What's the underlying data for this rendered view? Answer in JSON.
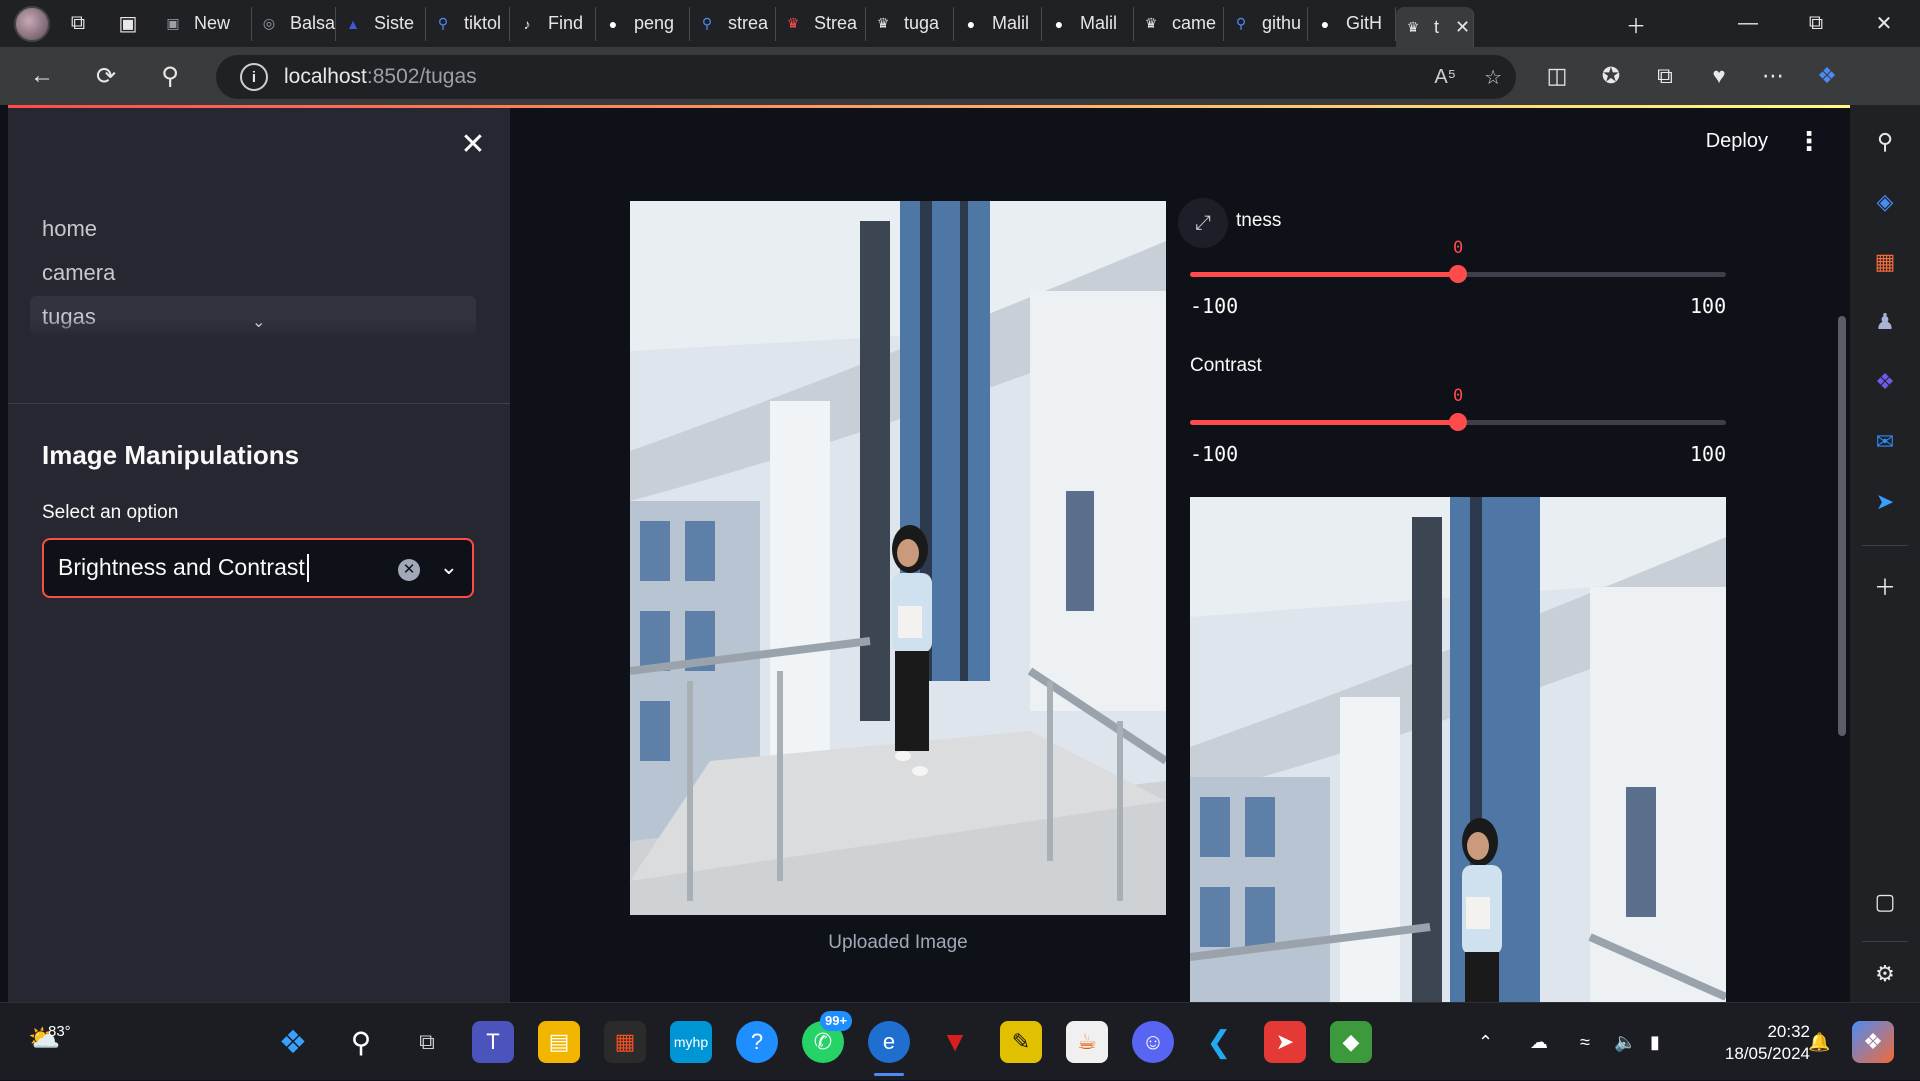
{
  "browser": {
    "tabs": [
      {
        "label": "New",
        "icon": "newtab-icon",
        "color": "#9aa0a6"
      },
      {
        "label": "Balsa",
        "icon": "globe-icon",
        "color": "#9aa0a6"
      },
      {
        "label": "Siste",
        "icon": "web-icon",
        "color": "#3b5bdb"
      },
      {
        "label": "tiktol",
        "icon": "search-icon",
        "color": "#4c8bf5"
      },
      {
        "label": "Find",
        "icon": "tiktok-icon",
        "color": "#e8e8e8"
      },
      {
        "label": "peng",
        "icon": "github-icon",
        "color": "#ffffff"
      },
      {
        "label": "strea",
        "icon": "search-icon",
        "color": "#4c8bf5"
      },
      {
        "label": "Strea",
        "icon": "streamlit-icon",
        "color": "#ff4b4b"
      },
      {
        "label": "tuga",
        "icon": "streamlit-icon",
        "color": "#e8e8e8"
      },
      {
        "label": "Malil",
        "icon": "github-icon",
        "color": "#ffffff"
      },
      {
        "label": "Malil",
        "icon": "github-icon",
        "color": "#ffffff"
      },
      {
        "label": "came",
        "icon": "streamlit-icon",
        "color": "#e8e8e8"
      },
      {
        "label": "githu",
        "icon": "search-icon",
        "color": "#4c8bf5"
      },
      {
        "label": "GitH",
        "icon": "github-icon",
        "color": "#ffffff"
      },
      {
        "label": "t",
        "icon": "streamlit-icon",
        "color": "#e8e8e8"
      }
    ],
    "url_host": "localhost",
    "url_rest": ":8502/tugas"
  },
  "sidebar": {
    "nav": [
      {
        "label": "home"
      },
      {
        "label": "camera"
      },
      {
        "label": "tugas"
      }
    ],
    "title": "Image Manipulations",
    "select_label": "Select an option",
    "select_value": "Brightness and Contrast"
  },
  "main": {
    "deploy_label": "Deploy",
    "caption": "Uploaded Image",
    "sliders": [
      {
        "label": "tness",
        "value": "0",
        "min": "-100",
        "max": "100",
        "fraction": 0.5
      },
      {
        "label": "Contrast",
        "value": "0",
        "min": "-100",
        "max": "100",
        "fraction": 0.5
      }
    ]
  },
  "taskbar": {
    "weather_temp": "83°",
    "whatsapp_badge": "99+",
    "time": "20:32",
    "date": "18/05/2024"
  },
  "colors": {
    "accent": "#ff4b4b",
    "sidebar_bg": "#262730",
    "main_bg": "#0e1117"
  }
}
